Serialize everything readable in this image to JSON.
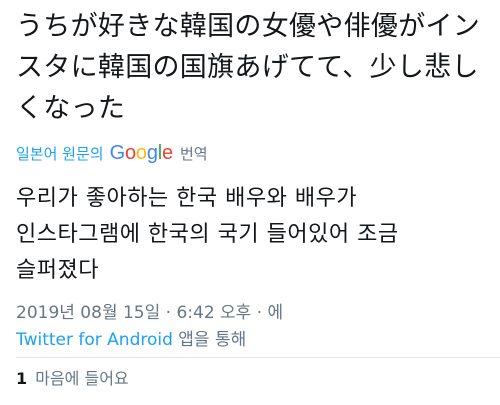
{
  "tweet": {
    "text": "うちが好きな韓国の女優や俳優がインスタに韓国の国旗あげてて、少し悲しくなった"
  },
  "translate": {
    "prefix": "일본어 원문의",
    "google_g1": "G",
    "google_o1": "o",
    "google_o2": "o",
    "google_g2": "g",
    "google_l": "l",
    "google_e": "e",
    "suffix": "번역"
  },
  "translation": {
    "text": "우리가 좋아하는 한국 배우와 배우가 인스타그램에 한국의 국기 들어있어 조금 슬퍼졌다"
  },
  "meta": {
    "timestamp": "2019년 08월 15일 · 6:42 오후 · 에",
    "via": "Twitter for Android",
    "via_suffix": "앱을 통해"
  },
  "likes": {
    "count": "1",
    "label": "마음에 들어요"
  }
}
